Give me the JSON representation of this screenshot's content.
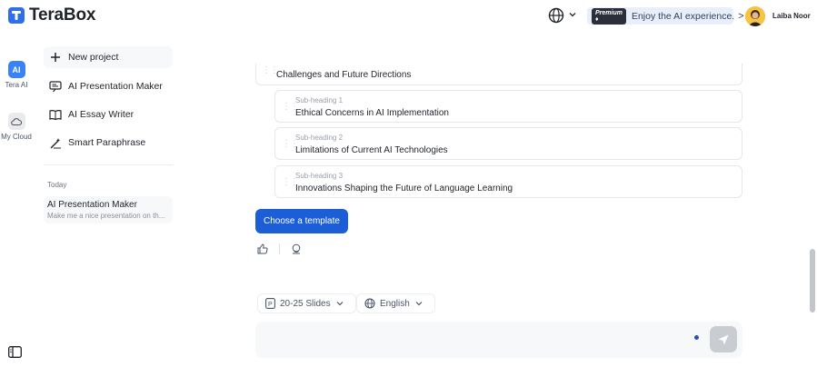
{
  "header": {
    "app_name": "TeraBox",
    "language_icon": "globe-icon",
    "promo": {
      "badge": "Premium ♦",
      "text": "Enjoy the AI experience.",
      "chevron": ">"
    },
    "user_name": "Laiba Noor"
  },
  "rail": {
    "items": [
      {
        "label": "Tera AI",
        "icon": "tera-ai-icon",
        "active": true
      },
      {
        "label": "My Cloud",
        "icon": "cloud-icon",
        "active": false
      }
    ]
  },
  "side": {
    "new_project": "New project",
    "items": [
      {
        "label": "AI Presentation Maker",
        "icon": "presentation-icon"
      },
      {
        "label": "AI Essay Writer",
        "icon": "essay-icon"
      },
      {
        "label": "Smart Paraphrase",
        "icon": "paraphrase-icon"
      }
    ],
    "history_heading": "Today",
    "history": [
      {
        "title": "AI Presentation Maker",
        "subtitle": "Make me a nice presentation on th..."
      }
    ]
  },
  "outline": {
    "section_title": "Challenges and Future Directions",
    "subheadings": [
      {
        "label": "Sub-heading 1",
        "text": "Ethical Concerns in AI Implementation"
      },
      {
        "label": "Sub-heading 2",
        "text": "Limitations of Current AI Technologies"
      },
      {
        "label": "Sub-heading 3",
        "text": "Innovations Shaping the Future of Language Learning"
      }
    ]
  },
  "actions": {
    "choose_template": "Choose a template"
  },
  "composer": {
    "slides_option": "20-25 Slides",
    "language_option": "English"
  },
  "colors": {
    "accent": "#1b5ed6",
    "rail_active": "#3b82f6"
  }
}
